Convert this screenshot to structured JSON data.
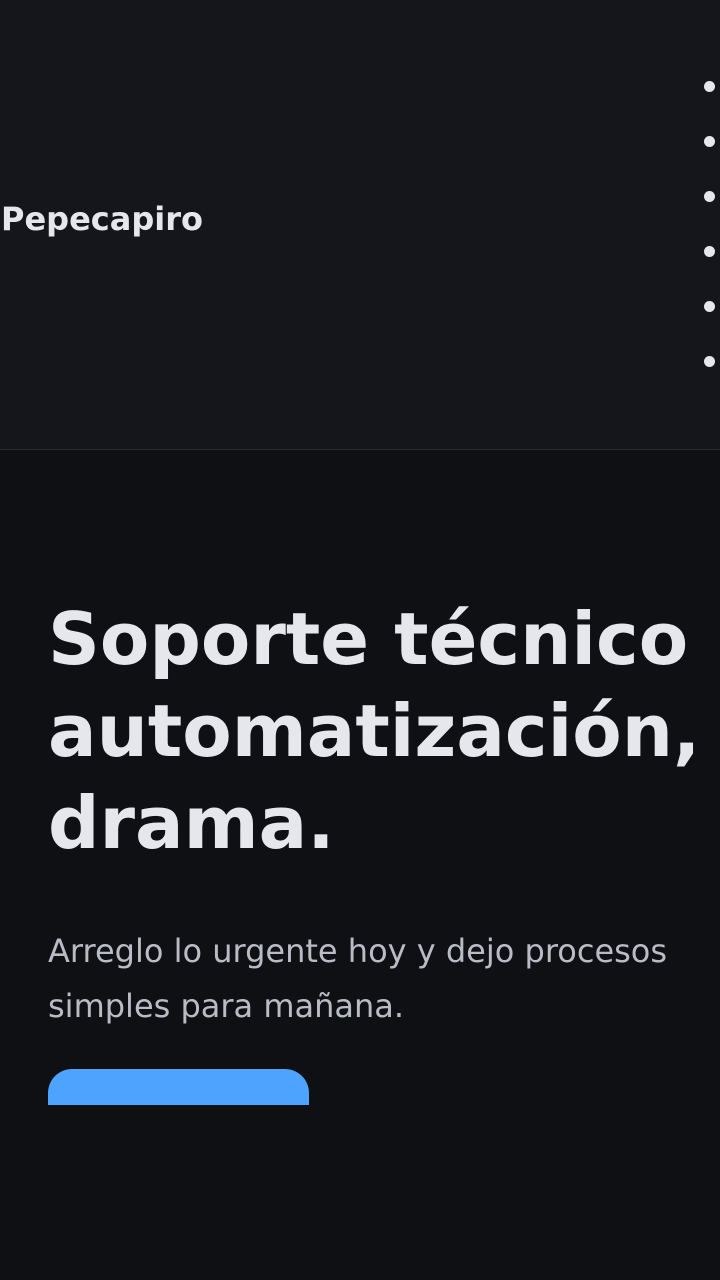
{
  "header": {
    "logo": "Pepecapiro",
    "nav_item_count_visible": 6
  },
  "hero": {
    "title_lines": [
      "Soporte técnico",
      "automatización,",
      "drama."
    ],
    "subtitle_lines": [
      "Arreglo lo urgente hoy y dejo procesos",
      "simples para mañana."
    ]
  },
  "colors": {
    "accent": "#4ea3ff",
    "header_bg": "#15161b",
    "page_bg": "#0f1014"
  }
}
